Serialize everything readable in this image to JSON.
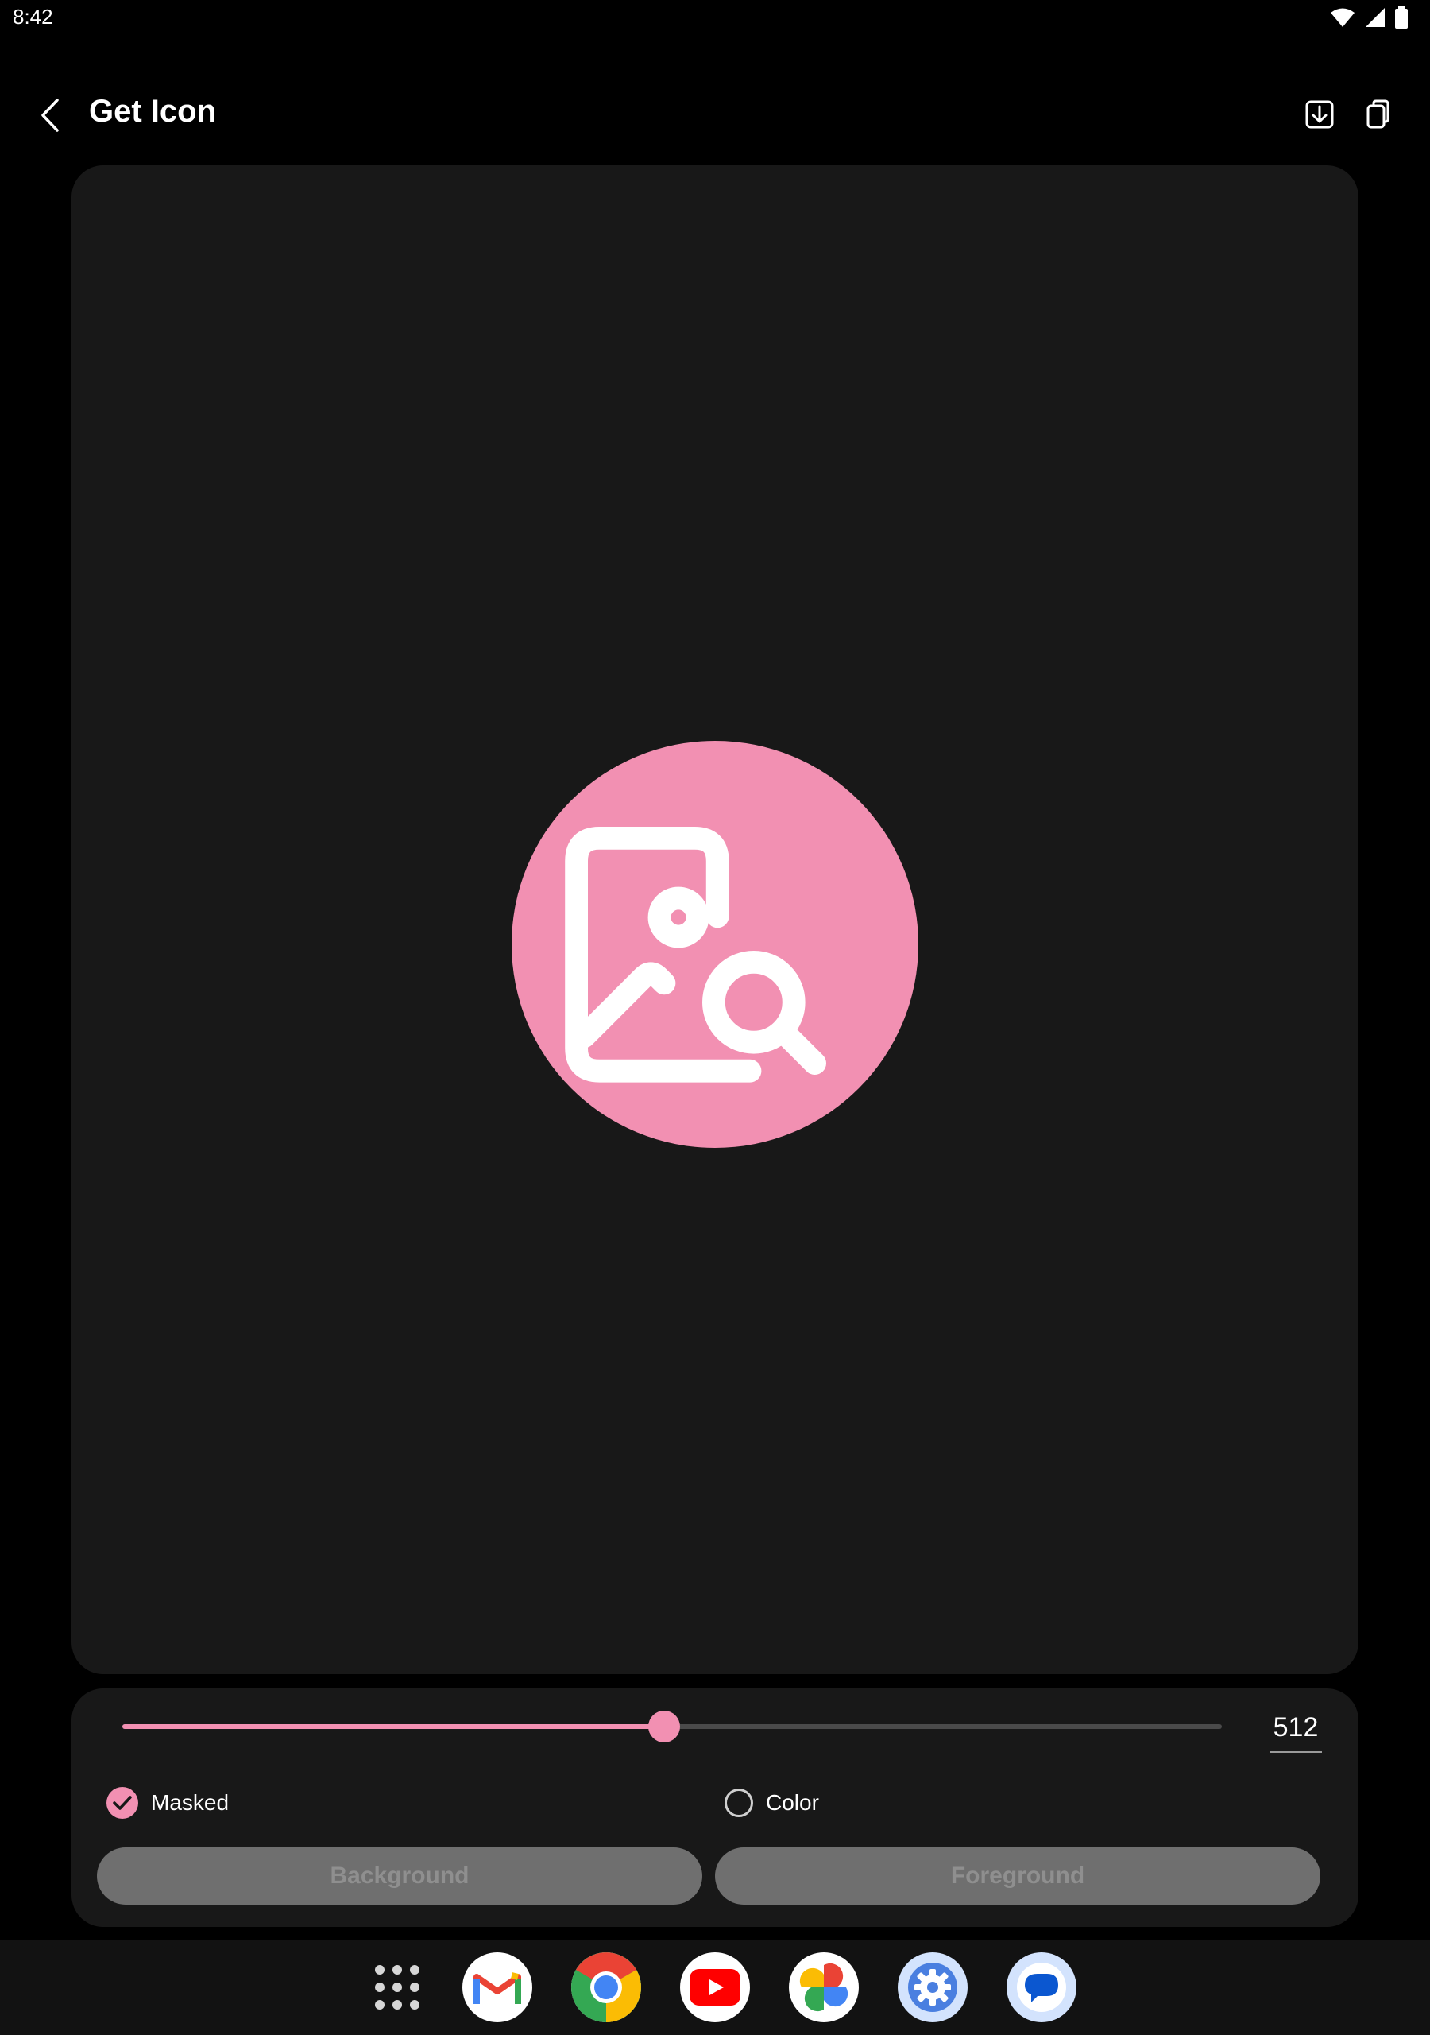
{
  "status_bar": {
    "time": "8:42",
    "icons": [
      "wifi-icon",
      "signal-icon",
      "battery-icon"
    ]
  },
  "app_bar": {
    "title": "Get Icon",
    "back_icon": "chevron-left-icon",
    "actions": [
      "download-icon",
      "copy-icon"
    ]
  },
  "preview": {
    "icon": "image-search-icon",
    "icon_bg_color": "#f290b2",
    "icon_fg_color": "#ffffff"
  },
  "controls": {
    "size_value": "512",
    "slider_fraction": 0.4929,
    "masked_label": "Masked",
    "masked_checked": true,
    "color_label": "Color",
    "color_checked": false,
    "background_button": "Background",
    "foreground_button": "Foreground"
  },
  "dock": {
    "apps": [
      "app-drawer-icon",
      "gmail-icon",
      "chrome-icon",
      "youtube-icon",
      "photos-icon",
      "settings-icon",
      "messages-icon"
    ]
  },
  "colors": {
    "accent": "#f290b2",
    "card_bg": "#181818",
    "page_bg": "#000000",
    "button_disabled_bg": "#6f6f6f"
  }
}
